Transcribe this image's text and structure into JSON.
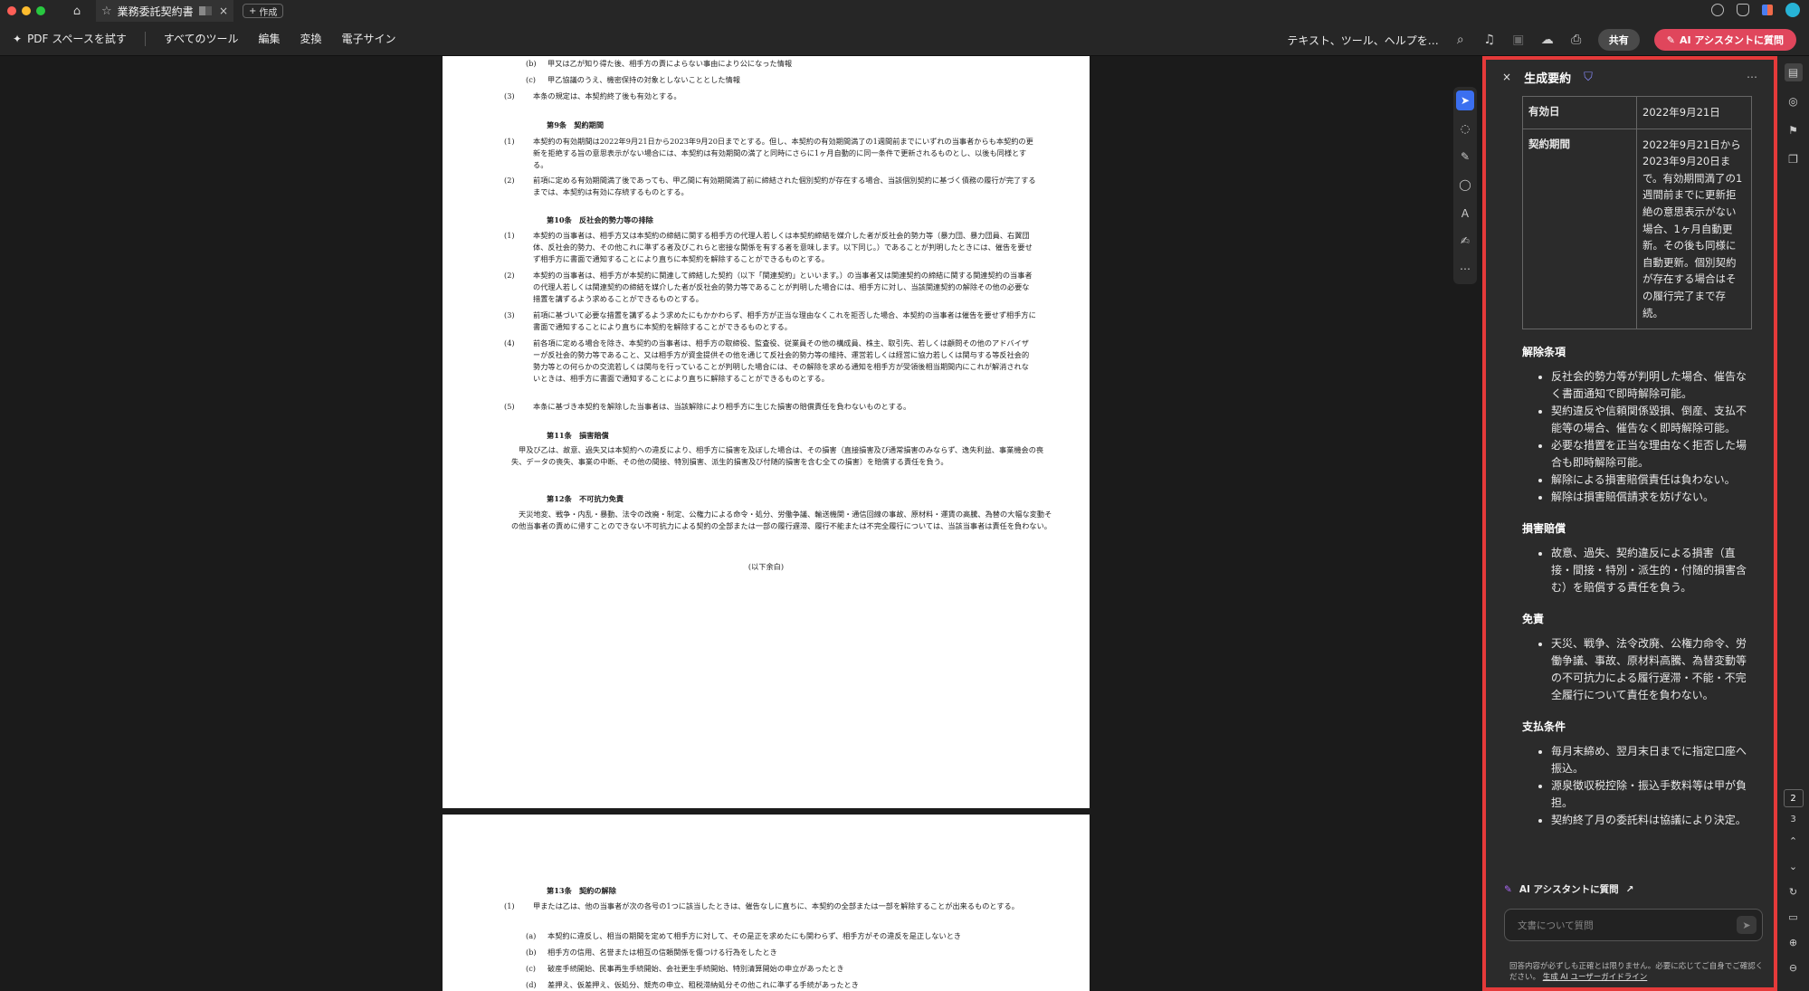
{
  "titlebar": {
    "tab_title": "業務委託契約書",
    "new_tab_label": "作成"
  },
  "menubar": {
    "try_label": "PDF スペースを試す",
    "items": [
      "すべてのツール",
      "編集",
      "変換",
      "電子サイン"
    ],
    "search_text": "テキスト、ツール、ヘルプを…",
    "share_label": "共有",
    "ai_button_label": "AI アシスタントに質問"
  },
  "document": {
    "page1": {
      "lines": [
        {
          "num": "(b)",
          "text": "甲又は乙が知り得た後、相手方の責によらない事由により公になった情報",
          "indent": "sub"
        },
        {
          "num": "(c)",
          "text": "甲乙協議のうえ、機密保持の対象としないこととした情報",
          "indent": "sub"
        },
        {
          "num": "(3)",
          "text": "本条の規定は、本契約終了後も有効とする。",
          "indent": "main"
        }
      ],
      "art9_heading": "第9条　契約期間",
      "art9": [
        {
          "num": "(1)",
          "text": "本契約の有効期間は2022年9月21日から2023年9月20日までとする。但し、本契約の有効期間満了の1週間前までにいずれの当事者からも本契約の更新を拒絶する旨の意思表示がない場合には、本契約は有効期間の満了と同時にさらに1ヶ月自動的に同一条件で更新されるものとし、以後も同様とする。"
        },
        {
          "num": "(2)",
          "text": "前項に定める有効期間満了後であっても、甲乙間に有効期間満了前に締結された個別契約が存在する場合、当該個別契約に基づく債務の履行が完了するまでは、本契約は有効に存続するものとする。"
        }
      ],
      "art10_heading": "第10条　反社会的勢力等の排除",
      "art10": [
        {
          "num": "(1)",
          "text": "本契約の当事者は、相手方又は本契約の締結に関する相手方の代理人若しくは本契約締結を媒介した者が反社会的勢力等（暴力団、暴力団員、右翼団体、反社会的勢力、その他これに準ずる者及びこれらと密接な関係を有する者を意味します。以下同じ。）であることが判明したときには、催告を要せず相手方に書面で通知することにより直ちに本契約を解除することができるものとする。"
        },
        {
          "num": "(2)",
          "text": "本契約の当事者は、相手方が本契約に関連して締結した契約（以下「関連契約」といいます。）の当事者又は関連契約の締結に関する関連契約の当事者の代理人若しくは関連契約の締結を媒介した者が反社会的勢力等であることが判明した場合には、相手方に対し、当該関連契約の解除その他の必要な措置を講ずるよう求めることができるものとする。"
        },
        {
          "num": "(3)",
          "text": "前項に基づいて必要な措置を講ずるよう求めたにもかかわらず、相手方が正当な理由なくこれを拒否した場合、本契約の当事者は催告を要せず相手方に書面で通知することにより直ちに本契約を解除することができるものとする。"
        },
        {
          "num": "(4)",
          "text": "前各項に定める場合を除き、本契約の当事者は、相手方の取締役、監査役、従業員その他の構成員、株主、取引先、若しくは顧問その他のアドバイザーが反社会的勢力等であること、又は相手方が資金提供その他を通じて反社会的勢力等の維持、運営若しくは経営に協力若しくは関与する等反社会的勢力等との何らかの交流若しくは関与を行っていることが判明した場合には、その解除を求める通知を相手方が受領後相当期間内にこれが解消されないときは、相手方に書面で通知することにより直ちに解除することができるものとする。"
        },
        {
          "num": "(5)",
          "text": "本条に基づき本契約を解除した当事者は、当該解除により相手方に生じた損害の賠償責任を負わないものとする。"
        }
      ],
      "art11_heading": "第11条　損害賠償",
      "art11_text": "甲及び乙は、故意、過失又は本契約への違反により、相手方に損害を及ぼした場合は、その損害（直接損害及び通常損害のみならず、逸失利益、事業機会の喪失、データの喪失、事業の中断、その他の間接、特別損害、派生的損害及び付随的損害を含む全ての損害）を賠償する責任を負う。",
      "art12_heading": "第12条　不可抗力免責",
      "art12_text": "天災地変、戦争・内乱・暴動、法令の改廃・制定、公権力による命令・処分、労働争議、輸送機関・通信回線の事故、原材料・運賃の高騰、為替の大幅な変動その他当事者の責めに帰すことのできない不可抗力による契約の全部または一部の履行遅滞、履行不能または不完全履行については、当該当事者は責任を負わない。",
      "end_text": "(以下余白)"
    },
    "page2": {
      "art13_heading": "第13条　契約の解除",
      "art13_intro_num": "(1)",
      "art13_intro": "甲または乙は、他の当事者が次の各号の1つに該当したときは、催告なしに直ちに、本契約の全部または一部を解除することが出来るものとする。",
      "items": [
        {
          "num": "(a)",
          "text": "本契約に違反し、相当の期間を定めて相手方に対して、その是正を求めたにも関わらず、相手方がその違反を是正しないとき"
        },
        {
          "num": "(b)",
          "text": "相手方の信用、名誉または相互の信頼関係を傷つける行為をしたとき"
        },
        {
          "num": "(c)",
          "text": "破産手続開始、民事再生手続開始、会社更生手続開始、特別清算開始の申立があったとき"
        },
        {
          "num": "(d)",
          "text": "差押え、仮差押え、仮処分、競売の申立、租税滞納処分その他これに準ずる手続があったとき"
        }
      ]
    }
  },
  "panel": {
    "title": "生成要約",
    "table": [
      {
        "key": "有効日",
        "value": "2022年9月21日"
      },
      {
        "key": "契約期間",
        "value": "2022年9月21日から2023年9月20日まで。有効期間満了の1週間前までに更新拒絶の意思表示がない場合、1ヶ月自動更新。その後も同様に自動更新。個別契約が存在する場合はその履行完了まで存続。"
      }
    ],
    "sections": [
      {
        "title": "解除条項",
        "items": [
          "反社会的勢力等が判明した場合、催告なく書面通知で即時解除可能。",
          "契約違反や信頼関係毀損、倒産、支払不能等の場合、催告なく即時解除可能。",
          "必要な措置を正当な理由なく拒否した場合も即時解除可能。",
          "解除による損害賠償責任は負わない。",
          "解除は損害賠償請求を妨げない。"
        ]
      },
      {
        "title": "損害賠償",
        "items": [
          "故意、過失、契約違反による損害（直接・間接・特別・派生的・付随的損害含む）を賠償する責任を負う。"
        ]
      },
      {
        "title": "免責",
        "items": [
          "天災、戦争、法令改廃、公権力命令、労働争議、事故、原材料高騰、為替変動等の不可抗力による履行遅滞・不能・不完全履行について責任を負わない。"
        ]
      },
      {
        "title": "支払条件",
        "items": [
          "毎月末締め、翌月末日までに指定口座へ振込。",
          "源泉徴収税控除・振込手数料等は甲が負担。",
          "契約終了月の委託料は協議により決定。"
        ]
      }
    ],
    "ask_label": "AI アシスタントに質問",
    "input_placeholder": "文書について質問",
    "disclaimer": "回答内容が必ずしも正確とは限りません。必要に応じてご自身でご確認ください。",
    "disclaimer_link": "生成 AI ユーザーガイドライン"
  },
  "rail": {
    "page_current": "2",
    "page_next": "3"
  },
  "colors": {
    "accent_red": "#e53a3a",
    "ai_pink": "#e0465c",
    "tool_blue": "#3b6ff0"
  }
}
